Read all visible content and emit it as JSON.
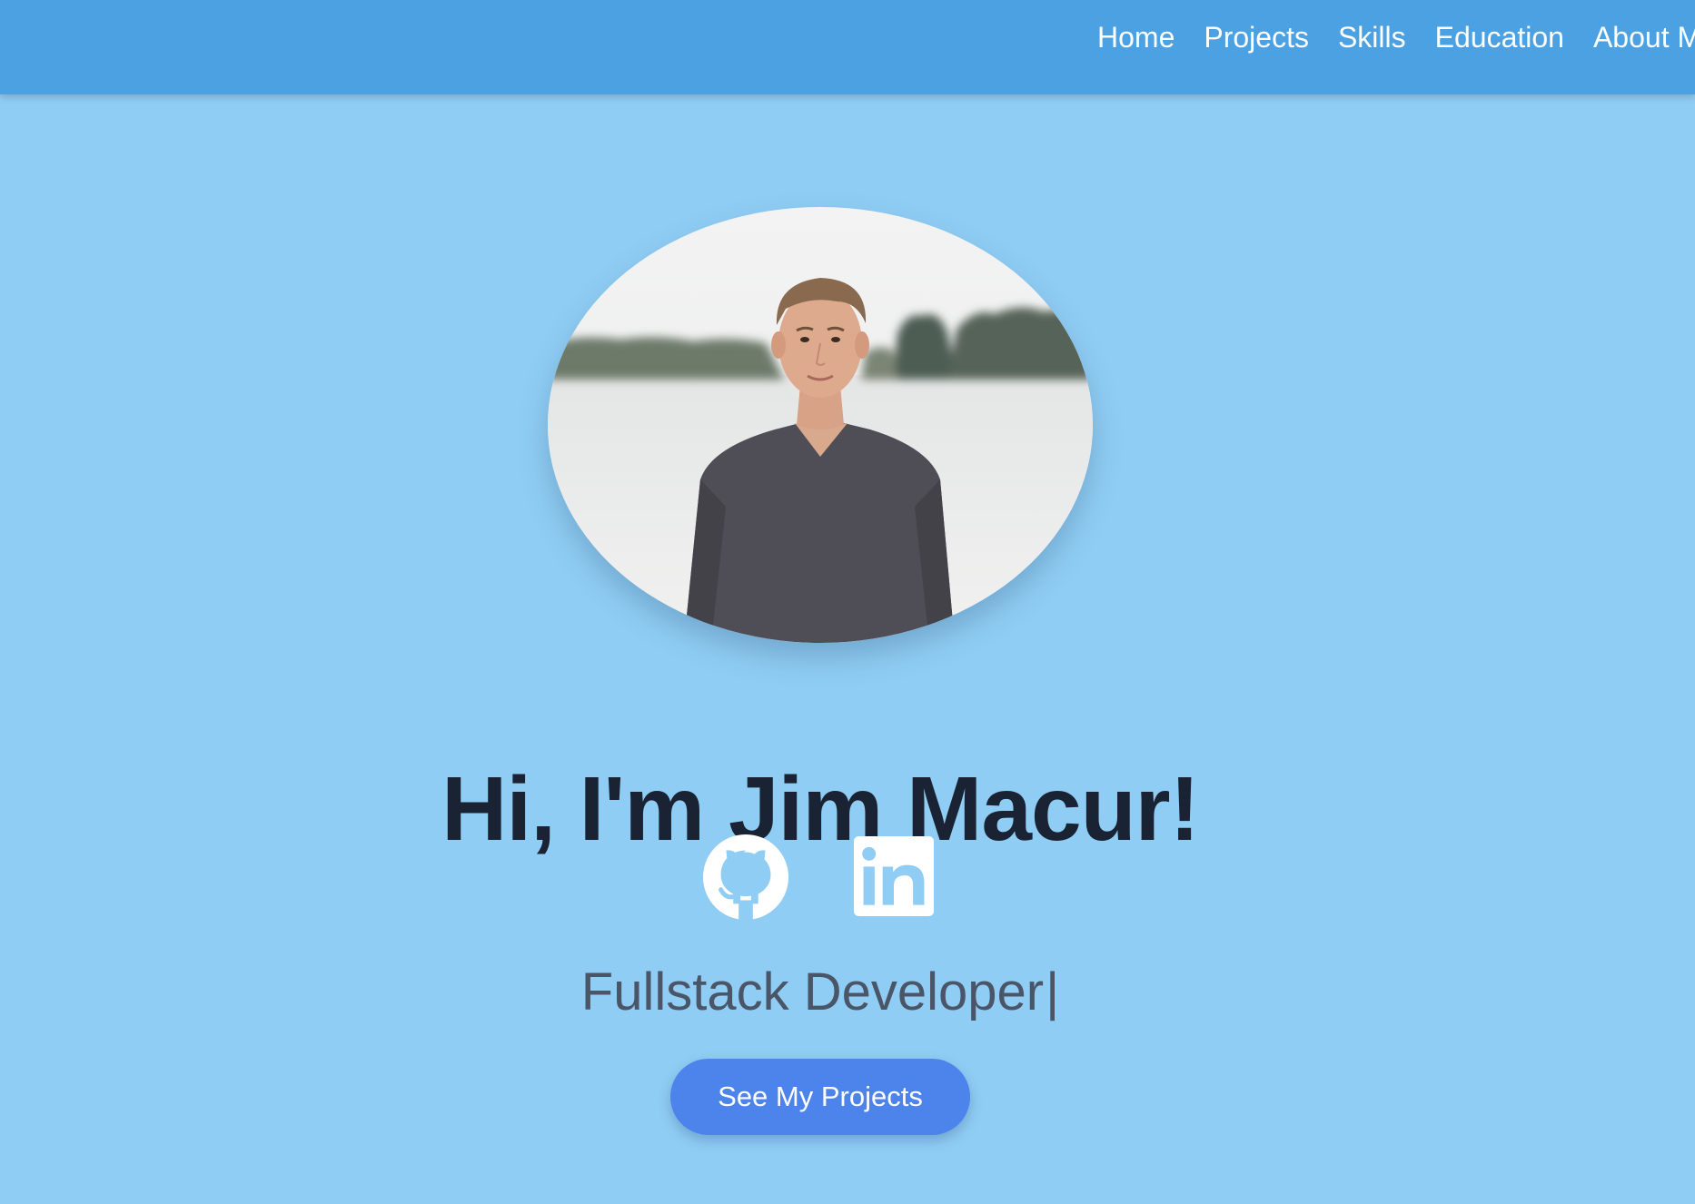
{
  "nav": {
    "items": [
      {
        "label": "Home"
      },
      {
        "label": "Projects"
      },
      {
        "label": "Skills"
      },
      {
        "label": "Education"
      },
      {
        "label": "About Me"
      }
    ]
  },
  "hero": {
    "title": "Hi, I'm Jim Macur!",
    "subtitle": "Fullstack Developer",
    "cursor": "|",
    "cta_label": "See My Projects"
  },
  "socials": [
    {
      "icon": "github-icon"
    },
    {
      "icon": "linkedin-icon"
    }
  ],
  "colors": {
    "navbar": "#4ba1e1",
    "background": "#90cdf4",
    "button": "#4c84ec",
    "title": "#1a2333",
    "subtitle": "#4a5568"
  }
}
